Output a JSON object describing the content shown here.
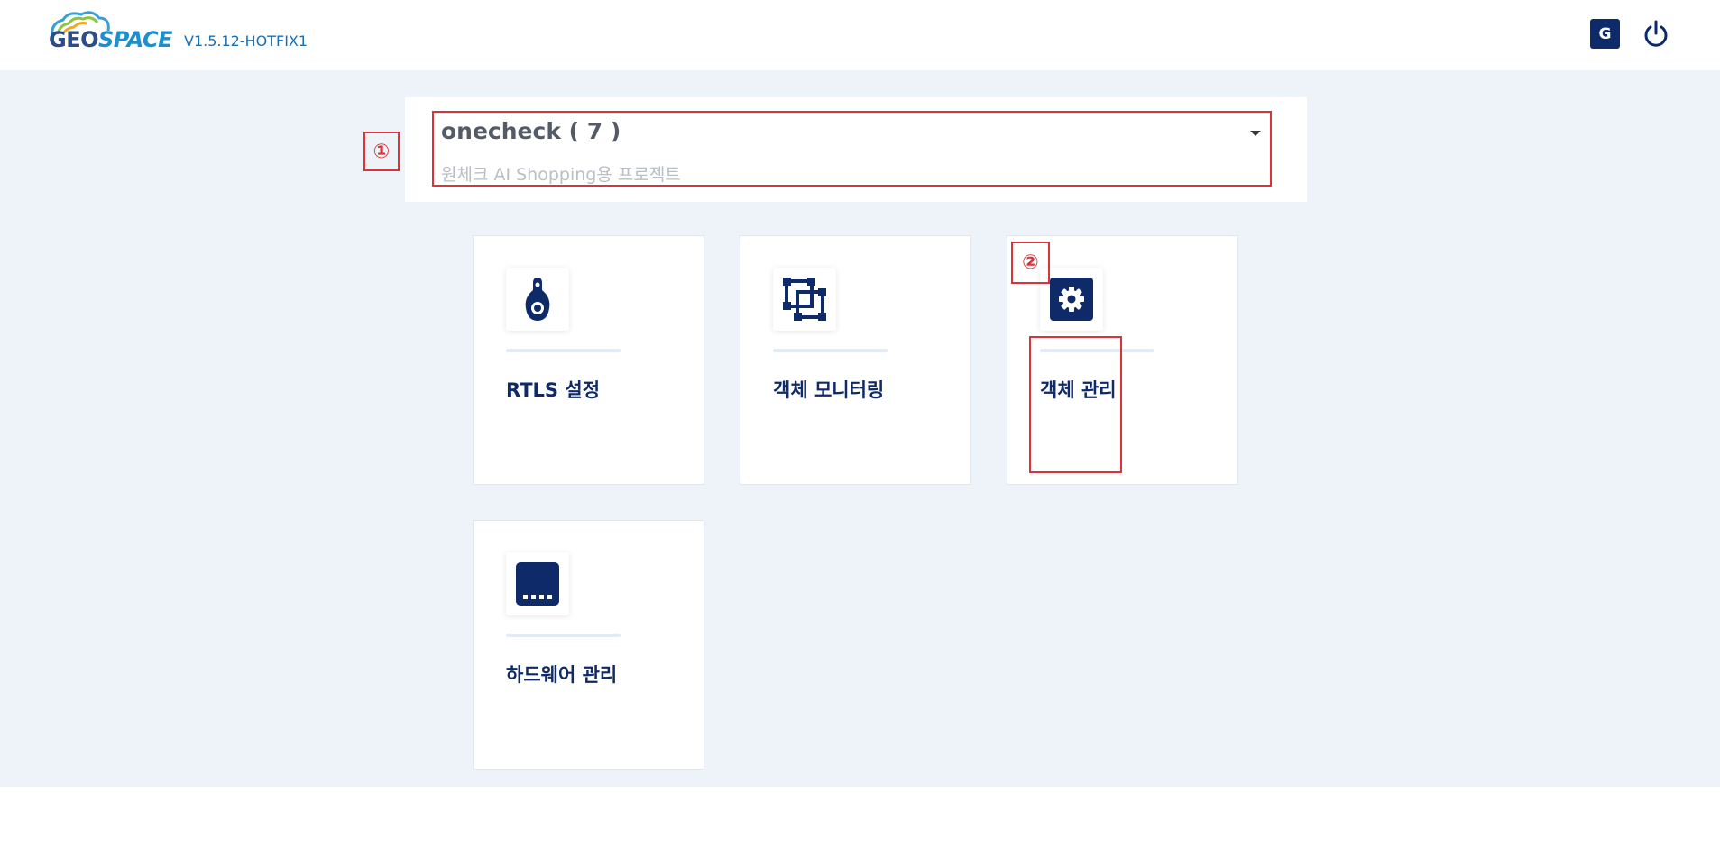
{
  "header": {
    "logo_geo": "GEO",
    "logo_space": "SPACE",
    "version": "V1.5.12-HOTFIX1",
    "user_initial": "G"
  },
  "project": {
    "name": "onecheck ( 7 )",
    "description": "원체크 AI Shopping용 프로젝트"
  },
  "markers": {
    "first": "①",
    "second": "②"
  },
  "cards": [
    {
      "label": "RTLS 설정",
      "icon": "location-tag-icon"
    },
    {
      "label": "객체 모니터링",
      "icon": "object-bounds-icon"
    },
    {
      "label": "객체 관리",
      "icon": "gear-icon"
    },
    {
      "label": "하드웨어 관리",
      "icon": "hardware-device-icon"
    }
  ],
  "colors": {
    "brand": "#0d2a6b",
    "accent_red": "#d9343a",
    "background": "#eef3fa"
  }
}
